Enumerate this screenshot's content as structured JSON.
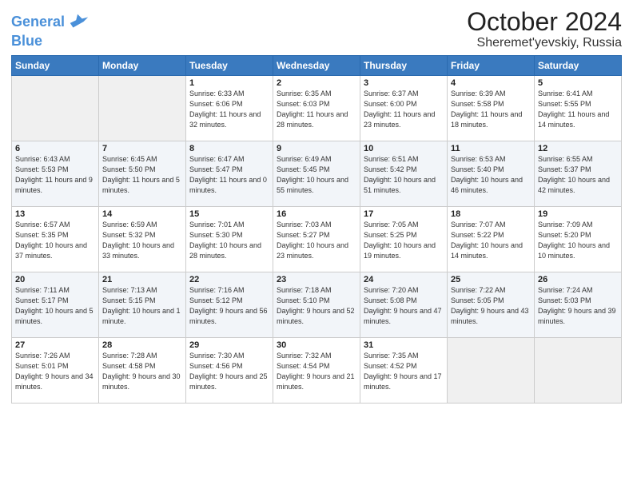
{
  "header": {
    "logo_line1": "General",
    "logo_line2": "Blue",
    "month": "October 2024",
    "location": "Sheremet'yevskiy, Russia"
  },
  "weekdays": [
    "Sunday",
    "Monday",
    "Tuesday",
    "Wednesday",
    "Thursday",
    "Friday",
    "Saturday"
  ],
  "weeks": [
    [
      {
        "day": "",
        "info": ""
      },
      {
        "day": "",
        "info": ""
      },
      {
        "day": "1",
        "info": "Sunrise: 6:33 AM\nSunset: 6:06 PM\nDaylight: 11 hours and 32 minutes."
      },
      {
        "day": "2",
        "info": "Sunrise: 6:35 AM\nSunset: 6:03 PM\nDaylight: 11 hours and 28 minutes."
      },
      {
        "day": "3",
        "info": "Sunrise: 6:37 AM\nSunset: 6:00 PM\nDaylight: 11 hours and 23 minutes."
      },
      {
        "day": "4",
        "info": "Sunrise: 6:39 AM\nSunset: 5:58 PM\nDaylight: 11 hours and 18 minutes."
      },
      {
        "day": "5",
        "info": "Sunrise: 6:41 AM\nSunset: 5:55 PM\nDaylight: 11 hours and 14 minutes."
      }
    ],
    [
      {
        "day": "6",
        "info": "Sunrise: 6:43 AM\nSunset: 5:53 PM\nDaylight: 11 hours and 9 minutes."
      },
      {
        "day": "7",
        "info": "Sunrise: 6:45 AM\nSunset: 5:50 PM\nDaylight: 11 hours and 5 minutes."
      },
      {
        "day": "8",
        "info": "Sunrise: 6:47 AM\nSunset: 5:47 PM\nDaylight: 11 hours and 0 minutes."
      },
      {
        "day": "9",
        "info": "Sunrise: 6:49 AM\nSunset: 5:45 PM\nDaylight: 10 hours and 55 minutes."
      },
      {
        "day": "10",
        "info": "Sunrise: 6:51 AM\nSunset: 5:42 PM\nDaylight: 10 hours and 51 minutes."
      },
      {
        "day": "11",
        "info": "Sunrise: 6:53 AM\nSunset: 5:40 PM\nDaylight: 10 hours and 46 minutes."
      },
      {
        "day": "12",
        "info": "Sunrise: 6:55 AM\nSunset: 5:37 PM\nDaylight: 10 hours and 42 minutes."
      }
    ],
    [
      {
        "day": "13",
        "info": "Sunrise: 6:57 AM\nSunset: 5:35 PM\nDaylight: 10 hours and 37 minutes."
      },
      {
        "day": "14",
        "info": "Sunrise: 6:59 AM\nSunset: 5:32 PM\nDaylight: 10 hours and 33 minutes."
      },
      {
        "day": "15",
        "info": "Sunrise: 7:01 AM\nSunset: 5:30 PM\nDaylight: 10 hours and 28 minutes."
      },
      {
        "day": "16",
        "info": "Sunrise: 7:03 AM\nSunset: 5:27 PM\nDaylight: 10 hours and 23 minutes."
      },
      {
        "day": "17",
        "info": "Sunrise: 7:05 AM\nSunset: 5:25 PM\nDaylight: 10 hours and 19 minutes."
      },
      {
        "day": "18",
        "info": "Sunrise: 7:07 AM\nSunset: 5:22 PM\nDaylight: 10 hours and 14 minutes."
      },
      {
        "day": "19",
        "info": "Sunrise: 7:09 AM\nSunset: 5:20 PM\nDaylight: 10 hours and 10 minutes."
      }
    ],
    [
      {
        "day": "20",
        "info": "Sunrise: 7:11 AM\nSunset: 5:17 PM\nDaylight: 10 hours and 5 minutes."
      },
      {
        "day": "21",
        "info": "Sunrise: 7:13 AM\nSunset: 5:15 PM\nDaylight: 10 hours and 1 minute."
      },
      {
        "day": "22",
        "info": "Sunrise: 7:16 AM\nSunset: 5:12 PM\nDaylight: 9 hours and 56 minutes."
      },
      {
        "day": "23",
        "info": "Sunrise: 7:18 AM\nSunset: 5:10 PM\nDaylight: 9 hours and 52 minutes."
      },
      {
        "day": "24",
        "info": "Sunrise: 7:20 AM\nSunset: 5:08 PM\nDaylight: 9 hours and 47 minutes."
      },
      {
        "day": "25",
        "info": "Sunrise: 7:22 AM\nSunset: 5:05 PM\nDaylight: 9 hours and 43 minutes."
      },
      {
        "day": "26",
        "info": "Sunrise: 7:24 AM\nSunset: 5:03 PM\nDaylight: 9 hours and 39 minutes."
      }
    ],
    [
      {
        "day": "27",
        "info": "Sunrise: 7:26 AM\nSunset: 5:01 PM\nDaylight: 9 hours and 34 minutes."
      },
      {
        "day": "28",
        "info": "Sunrise: 7:28 AM\nSunset: 4:58 PM\nDaylight: 9 hours and 30 minutes."
      },
      {
        "day": "29",
        "info": "Sunrise: 7:30 AM\nSunset: 4:56 PM\nDaylight: 9 hours and 25 minutes."
      },
      {
        "day": "30",
        "info": "Sunrise: 7:32 AM\nSunset: 4:54 PM\nDaylight: 9 hours and 21 minutes."
      },
      {
        "day": "31",
        "info": "Sunrise: 7:35 AM\nSunset: 4:52 PM\nDaylight: 9 hours and 17 minutes."
      },
      {
        "day": "",
        "info": ""
      },
      {
        "day": "",
        "info": ""
      }
    ]
  ]
}
